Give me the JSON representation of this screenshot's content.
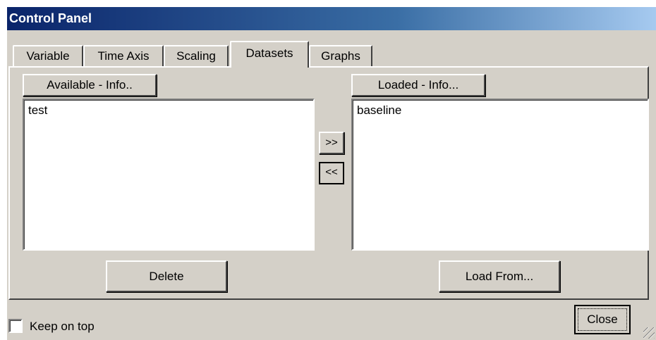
{
  "window": {
    "title": "Control Panel"
  },
  "tabs": [
    {
      "label": "Variable"
    },
    {
      "label": "Time Axis"
    },
    {
      "label": "Scaling"
    },
    {
      "label": "Datasets",
      "active": true
    },
    {
      "label": "Graphs"
    }
  ],
  "available": {
    "header_label": "Available - Info..",
    "items": [
      "test"
    ],
    "delete_label": "Delete"
  },
  "loaded": {
    "header_label": "Loaded - Info...",
    "items": [
      "baseline"
    ],
    "load_label": "Load From..."
  },
  "transfer": {
    "add_label": ">>",
    "remove_label": "<<"
  },
  "footer": {
    "keep_on_top_label": "Keep on top",
    "keep_on_top_checked": false,
    "close_label": "Close"
  }
}
